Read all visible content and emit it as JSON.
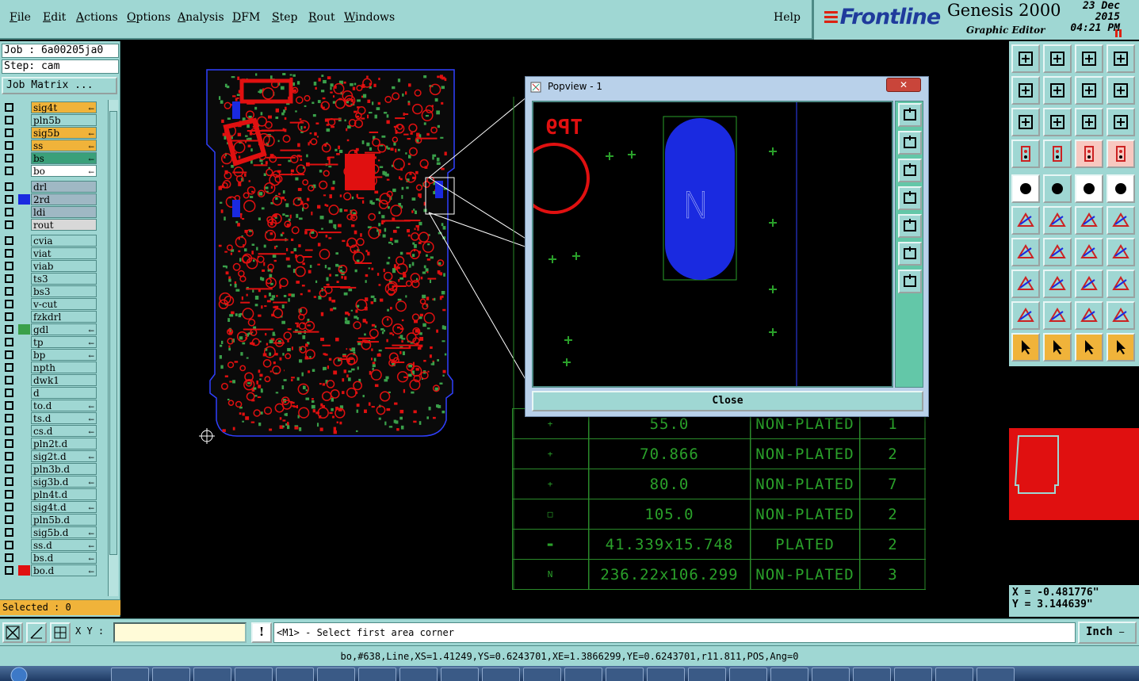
{
  "menu": {
    "items": [
      "File",
      "Edit",
      "Actions",
      "Options",
      "Analysis",
      "DFM",
      "Step",
      "Rout",
      "Windows"
    ],
    "help": "Help"
  },
  "brand": {
    "logo": "Frontline",
    "product": "Genesis 2000",
    "subtitle": "Graphic Editor",
    "date": "23 Dec 2015",
    "time": "04:21 PM"
  },
  "job": {
    "job_label": "Job : 6a00205ja0",
    "step_label": "Step: cam",
    "matrix_button": "Job Matrix ..."
  },
  "layers": [
    {
      "name": "sig4t",
      "color": "#f0b33a",
      "swatch": "",
      "mark": "←"
    },
    {
      "name": "pln5b",
      "color": "#9fd7d3",
      "swatch": "",
      "mark": ""
    },
    {
      "name": "sig5b",
      "color": "#f0b33a",
      "swatch": "",
      "mark": "←"
    },
    {
      "name": "ss",
      "color": "#f0b33a",
      "swatch": "",
      "mark": "←"
    },
    {
      "name": "bs",
      "color": "#3aa07a",
      "swatch": "",
      "mark": "←"
    },
    {
      "name": "bo",
      "color": "#ffffff",
      "swatch": "",
      "mark": "←"
    },
    {
      "name": "drl",
      "color": "#9fb8c4",
      "swatch": "",
      "mark": ""
    },
    {
      "name": "2rd",
      "color": "#9fb8c4",
      "swatch": "#1a2ae0",
      "mark": ""
    },
    {
      "name": "ldi",
      "color": "#9fb8c4",
      "swatch": "",
      "mark": ""
    },
    {
      "name": "rout",
      "color": "#d8d8d8",
      "swatch": "",
      "mark": ""
    },
    {
      "name": "cvia",
      "color": "#9fd7d3",
      "swatch": "",
      "mark": ""
    },
    {
      "name": "viat",
      "color": "#9fd7d3",
      "swatch": "",
      "mark": ""
    },
    {
      "name": "viab",
      "color": "#9fd7d3",
      "swatch": "",
      "mark": ""
    },
    {
      "name": "ts3",
      "color": "#9fd7d3",
      "swatch": "",
      "mark": ""
    },
    {
      "name": "bs3",
      "color": "#9fd7d3",
      "swatch": "",
      "mark": ""
    },
    {
      "name": "v-cut",
      "color": "#9fd7d3",
      "swatch": "",
      "mark": ""
    },
    {
      "name": "fzkdrl",
      "color": "#9fd7d3",
      "swatch": "",
      "mark": ""
    },
    {
      "name": "gdl",
      "color": "#9fd7d3",
      "swatch": "#3aa04a",
      "mark": "←"
    },
    {
      "name": "tp",
      "color": "#9fd7d3",
      "swatch": "",
      "mark": "←"
    },
    {
      "name": "bp",
      "color": "#9fd7d3",
      "swatch": "",
      "mark": "←"
    },
    {
      "name": "npth",
      "color": "#9fd7d3",
      "swatch": "",
      "mark": ""
    },
    {
      "name": "dwk1",
      "color": "#9fd7d3",
      "swatch": "",
      "mark": ""
    },
    {
      "name": "d",
      "color": "#9fd7d3",
      "swatch": "",
      "mark": ""
    },
    {
      "name": "to.d",
      "color": "#9fd7d3",
      "swatch": "",
      "mark": "←"
    },
    {
      "name": "ts.d",
      "color": "#9fd7d3",
      "swatch": "",
      "mark": "←"
    },
    {
      "name": "cs.d",
      "color": "#9fd7d3",
      "swatch": "",
      "mark": "←"
    },
    {
      "name": "pln2t.d",
      "color": "#9fd7d3",
      "swatch": "",
      "mark": ""
    },
    {
      "name": "sig2t.d",
      "color": "#9fd7d3",
      "swatch": "",
      "mark": "←"
    },
    {
      "name": "pln3b.d",
      "color": "#9fd7d3",
      "swatch": "",
      "mark": ""
    },
    {
      "name": "sig3b.d",
      "color": "#9fd7d3",
      "swatch": "",
      "mark": "←"
    },
    {
      "name": "pln4t.d",
      "color": "#9fd7d3",
      "swatch": "",
      "mark": ""
    },
    {
      "name": "sig4t.d",
      "color": "#9fd7d3",
      "swatch": "",
      "mark": "←"
    },
    {
      "name": "pln5b.d",
      "color": "#9fd7d3",
      "swatch": "",
      "mark": ""
    },
    {
      "name": "sig5b.d",
      "color": "#9fd7d3",
      "swatch": "",
      "mark": "←"
    },
    {
      "name": "ss.d",
      "color": "#9fd7d3",
      "swatch": "",
      "mark": "←"
    },
    {
      "name": "bs.d",
      "color": "#9fd7d3",
      "swatch": "",
      "mark": "←"
    },
    {
      "name": "bo.d",
      "color": "#9fd7d3",
      "swatch": "#e01010",
      "mark": "←"
    }
  ],
  "selected": "Selected : 0",
  "popview": {
    "title": "Popview - 1",
    "close_label": "Close",
    "close_x": "✕",
    "label_text": "TP9",
    "slot_symbol": "N"
  },
  "drill_table": {
    "rows": [
      {
        "size": "55.0",
        "type": "NON-PLATED",
        "count": "1",
        "sym": "+"
      },
      {
        "size": "70.866",
        "type": "NON-PLATED",
        "count": "2",
        "sym": "+"
      },
      {
        "size": "80.0",
        "type": "NON-PLATED",
        "count": "7",
        "sym": "+"
      },
      {
        "size": "105.0",
        "type": "NON-PLATED",
        "count": "2",
        "sym": "□"
      },
      {
        "size": "41.339x15.748",
        "type": "PLATED",
        "count": "2",
        "sym": "▬"
      },
      {
        "size": "236.22x106.299",
        "type": "NON-PLATED",
        "count": "3",
        "sym": "N"
      }
    ]
  },
  "coords": {
    "x": "X = -0.481776\"",
    "y": "Y = 3.144639\""
  },
  "prompt": {
    "xy_label": "X Y :",
    "xy_value": "",
    "bang": "!",
    "message": "<M1> - Select first area corner",
    "units": "Inch"
  },
  "status_line": "bo,#638,Line,XS=1.41249,YS=0.6243701,XE=1.3866299,YE=0.6243701,r11.811,POS,Ang=0",
  "colors": {
    "panel": "#9fd7d3",
    "board_red": "#e01010",
    "board_green": "#3aa04a",
    "outline_blue": "#3040ff"
  }
}
